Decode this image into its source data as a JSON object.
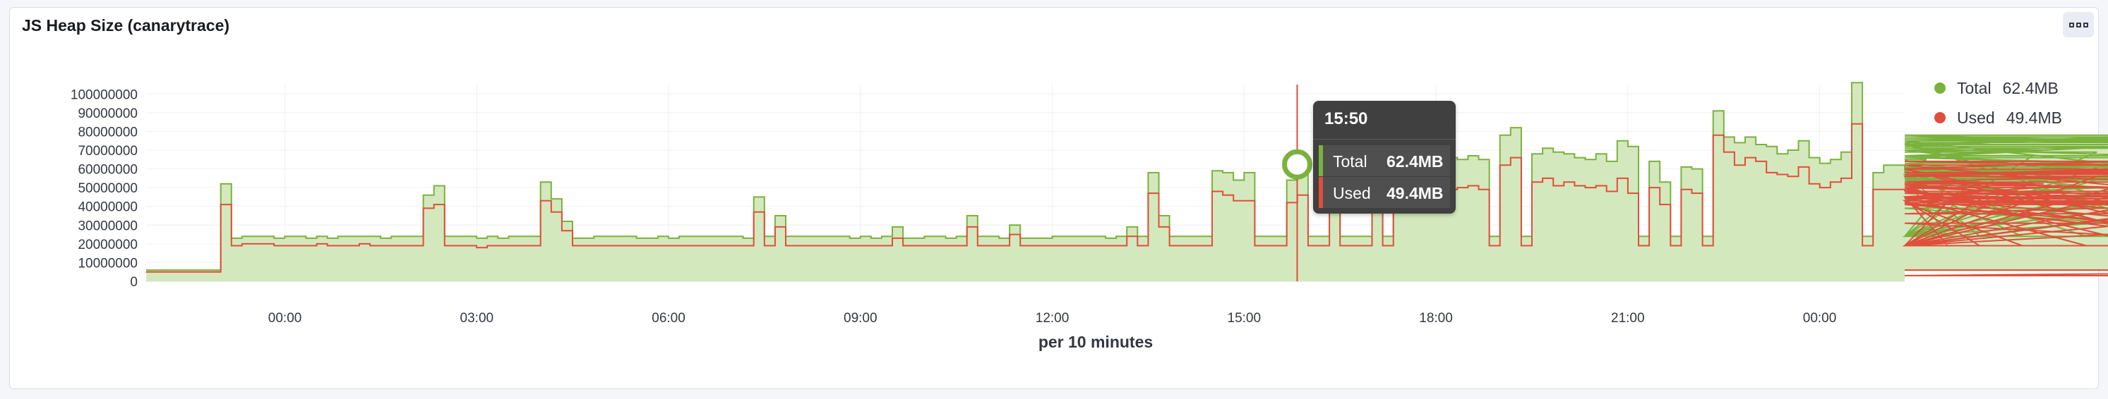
{
  "panel": {
    "title": "JS Heap Size (canarytrace)"
  },
  "colors": {
    "total": "#7ab23d",
    "total_fill": "#d4e8bd",
    "used": "#e04e3c",
    "cursor": "#e04e3c"
  },
  "legend": [
    {
      "name": "Total",
      "value": "62.4MB"
    },
    {
      "name": "Used",
      "value": "49.4MB"
    }
  ],
  "tooltip": {
    "time": "15:50",
    "rows": [
      {
        "name": "Total",
        "value": "62.4MB"
      },
      {
        "name": "Used",
        "value": "49.4MB"
      }
    ]
  },
  "chart_data": {
    "type": "area",
    "title": "JS Heap Size (canarytrace)",
    "xlabel": "per 10 minutes",
    "ylabel": "",
    "ylim": [
      0,
      105000000
    ],
    "grid": true,
    "legend_position": "right",
    "y_ticks": [
      "0",
      "10000000",
      "20000000",
      "30000000",
      "40000000",
      "50000000",
      "60000000",
      "70000000",
      "80000000",
      "90000000",
      "100000000"
    ],
    "x_ticks": [
      {
        "label": "00:00",
        "hour": 0
      },
      {
        "label": "03:00",
        "hour": 3
      },
      {
        "label": "06:00",
        "hour": 6
      },
      {
        "label": "09:00",
        "hour": 9
      },
      {
        "label": "12:00",
        "hour": 12
      },
      {
        "label": "15:00",
        "hour": 15
      },
      {
        "label": "18:00",
        "hour": 18
      },
      {
        "label": "21:00",
        "hour": 21
      },
      {
        "label": "00:00",
        "hour": 24
      }
    ],
    "x_range_hours": [
      -2.17,
      25.33
    ],
    "cursor_hour": 15.83,
    "step_hours": 0.1667,
    "series": [
      {
        "name": "Total",
        "values": [
          6,
          6,
          6,
          6,
          6,
          6,
          6,
          52,
          23,
          24,
          24,
          24,
          23,
          24,
          24,
          23,
          24,
          23,
          24,
          24,
          24,
          24,
          23,
          24,
          24,
          24,
          46,
          51,
          24,
          24,
          24,
          23,
          24,
          23,
          24,
          24,
          24,
          53,
          44,
          32,
          23,
          23,
          24,
          24,
          24,
          24,
          23,
          23,
          24,
          23,
          24,
          24,
          24,
          24,
          24,
          24,
          23,
          45,
          24,
          35,
          24,
          24,
          24,
          24,
          24,
          24,
          23,
          24,
          23,
          24,
          29,
          23,
          23,
          24,
          24,
          23,
          24,
          35,
          24,
          24,
          23,
          30,
          23,
          23,
          23,
          24,
          24,
          24,
          24,
          24,
          23,
          24,
          29,
          24,
          58,
          35,
          24,
          24,
          24,
          24,
          59,
          58,
          54,
          58,
          24,
          24,
          24,
          54,
          59,
          24,
          24,
          58,
          24,
          24,
          24,
          71,
          24,
          64,
          60,
          68,
          66,
          64,
          66,
          65,
          67,
          65,
          24,
          78,
          82,
          24,
          68,
          71,
          69,
          68,
          66,
          65,
          68,
          64,
          75,
          72,
          24,
          64,
          53,
          24,
          61,
          60,
          24,
          91,
          77,
          74,
          77,
          73,
          72,
          68,
          70,
          75,
          66,
          63,
          65,
          69,
          106,
          24,
          58,
          62,
          62,
          58,
          60,
          65,
          56,
          24,
          58,
          57,
          24,
          60,
          55,
          52,
          24,
          67,
          70,
          60,
          63,
          55,
          24,
          69,
          72,
          77,
          75,
          61,
          24,
          73,
          78,
          74,
          24,
          71,
          66,
          75,
          76,
          73,
          24,
          66,
          61,
          39,
          24,
          59,
          56,
          24,
          64,
          57,
          67,
          56,
          55,
          54,
          24,
          58,
          24,
          24,
          24,
          24,
          24,
          45,
          60,
          60,
          58,
          57,
          6,
          6,
          6,
          6,
          6,
          6,
          6,
          6
        ],
        "unit": "MB"
      },
      {
        "name": "Used",
        "values": [
          5,
          5,
          5,
          5,
          5,
          5,
          5,
          41,
          19,
          20,
          20,
          20,
          19,
          19,
          19,
          19,
          20,
          19,
          19,
          19,
          20,
          19,
          19,
          19,
          19,
          19,
          39,
          41,
          19,
          19,
          19,
          18,
          19,
          19,
          19,
          19,
          19,
          43,
          37,
          27,
          19,
          19,
          19,
          19,
          19,
          19,
          19,
          19,
          19,
          19,
          19,
          19,
          19,
          19,
          19,
          19,
          19,
          37,
          19,
          29,
          19,
          19,
          19,
          19,
          19,
          19,
          19,
          19,
          19,
          19,
          23,
          19,
          19,
          19,
          19,
          19,
          19,
          29,
          19,
          19,
          19,
          25,
          19,
          19,
          19,
          19,
          19,
          19,
          19,
          19,
          19,
          19,
          24,
          19,
          47,
          29,
          19,
          19,
          19,
          19,
          48,
          46,
          43,
          43,
          19,
          19,
          19,
          42,
          46,
          19,
          19,
          48,
          19,
          19,
          19,
          56,
          19,
          48,
          49,
          53,
          48,
          48,
          49,
          50,
          51,
          49,
          19,
          62,
          66,
          19,
          53,
          55,
          51,
          53,
          51,
          50,
          51,
          48,
          55,
          47,
          19,
          50,
          41,
          19,
          49,
          47,
          19,
          78,
          69,
          62,
          66,
          64,
          58,
          57,
          56,
          61,
          52,
          50,
          53,
          55,
          84,
          19,
          49,
          49,
          49,
          48,
          49,
          50,
          45,
          19,
          48,
          43,
          19,
          47,
          45,
          42,
          19,
          53,
          52,
          45,
          51,
          45,
          19,
          56,
          60,
          64,
          62,
          50,
          19,
          57,
          60,
          60,
          19,
          57,
          53,
          58,
          57,
          60,
          19,
          53,
          48,
          31,
          19,
          47,
          44,
          19,
          50,
          42,
          43,
          42,
          42,
          41,
          19,
          45,
          19,
          19,
          19,
          19,
          19,
          36,
          45,
          45,
          42,
          42,
          3,
          6,
          6,
          6,
          6,
          6,
          6,
          6
        ],
        "unit": "MB"
      }
    ]
  }
}
